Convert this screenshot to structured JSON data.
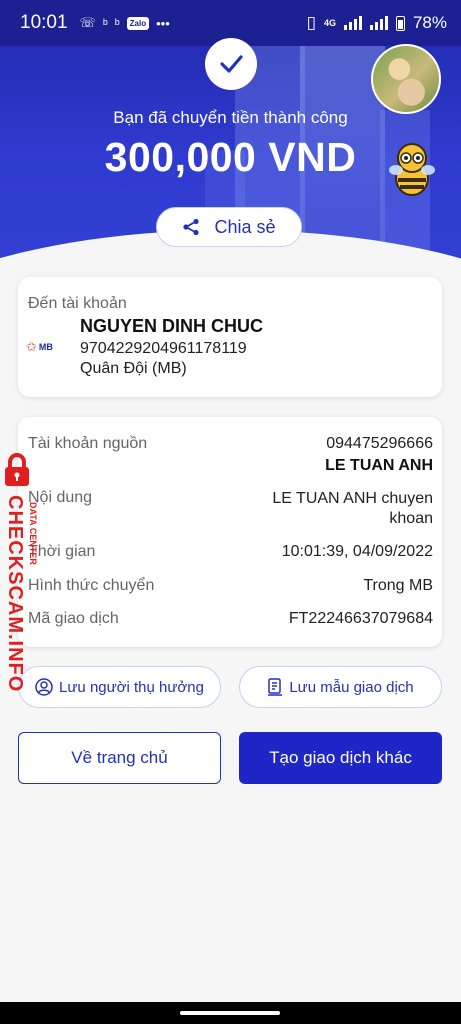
{
  "status_bar": {
    "time": "10:01",
    "zalo_label": "Zalo",
    "network": "4G",
    "battery": "78%"
  },
  "header": {
    "success_message": "Bạn đã chuyển tiền thành công",
    "amount": "300,000 VND",
    "share_label": "Chia sẻ"
  },
  "recipient": {
    "label": "Đến tài khoản",
    "bank_logo": "MB",
    "name": "NGUYEN DINH CHUC",
    "account_number": "9704229204961178119",
    "bank_name": "Quân Đội (MB)"
  },
  "details": {
    "source_label": "Tài khoản nguồn",
    "source_account": "094475296666",
    "source_name": "LE TUAN ANH",
    "content_label": "Nội dung",
    "content_line1": "LE TUAN ANH chuyen",
    "content_line2": "khoan",
    "time_label": "Thời gian",
    "time_value": "10:01:39, 04/09/2022",
    "method_label": "Hình thức chuyển",
    "method_value": "Trong MB",
    "txn_label": "Mã giao dịch",
    "txn_value": "FT22246637079684"
  },
  "actions": {
    "save_recipient": "Lưu người thụ hưởng",
    "save_template": "Lưu mẫu giao dịch",
    "home": "Về trang chủ",
    "new_transaction": "Tạo giao dịch khác"
  },
  "watermark": {
    "main": "CHECKSCAM.INFO",
    "sub": "DATA CENTER"
  },
  "colors": {
    "primary": "#1f26c8",
    "hero": "#2f3bd0"
  }
}
